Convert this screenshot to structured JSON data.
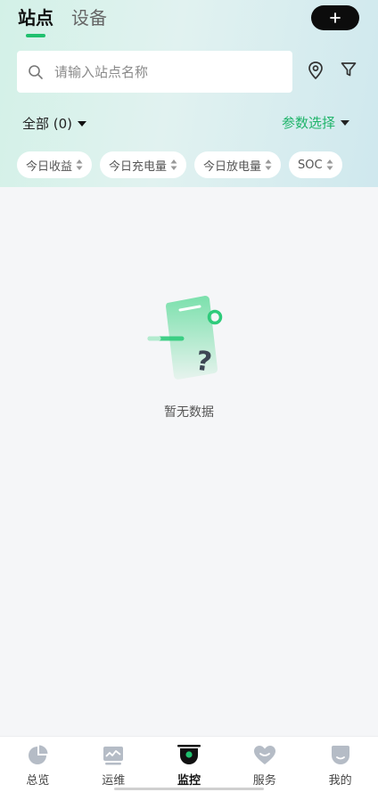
{
  "tabs": {
    "active": "站点",
    "inactive": "设备"
  },
  "search": {
    "placeholder": "请输入站点名称"
  },
  "filters": {
    "all_label": "全部 (0)",
    "param_label": "参数选择"
  },
  "chips": [
    "今日收益",
    "今日充电量",
    "今日放电量",
    "SOC"
  ],
  "empty": {
    "text": "暂无数据"
  },
  "tabbar": [
    "总览",
    "运维",
    "监控",
    "服务",
    "我的"
  ],
  "colors": {
    "accent": "#1fc06e",
    "param_text": "#1fb46a"
  }
}
